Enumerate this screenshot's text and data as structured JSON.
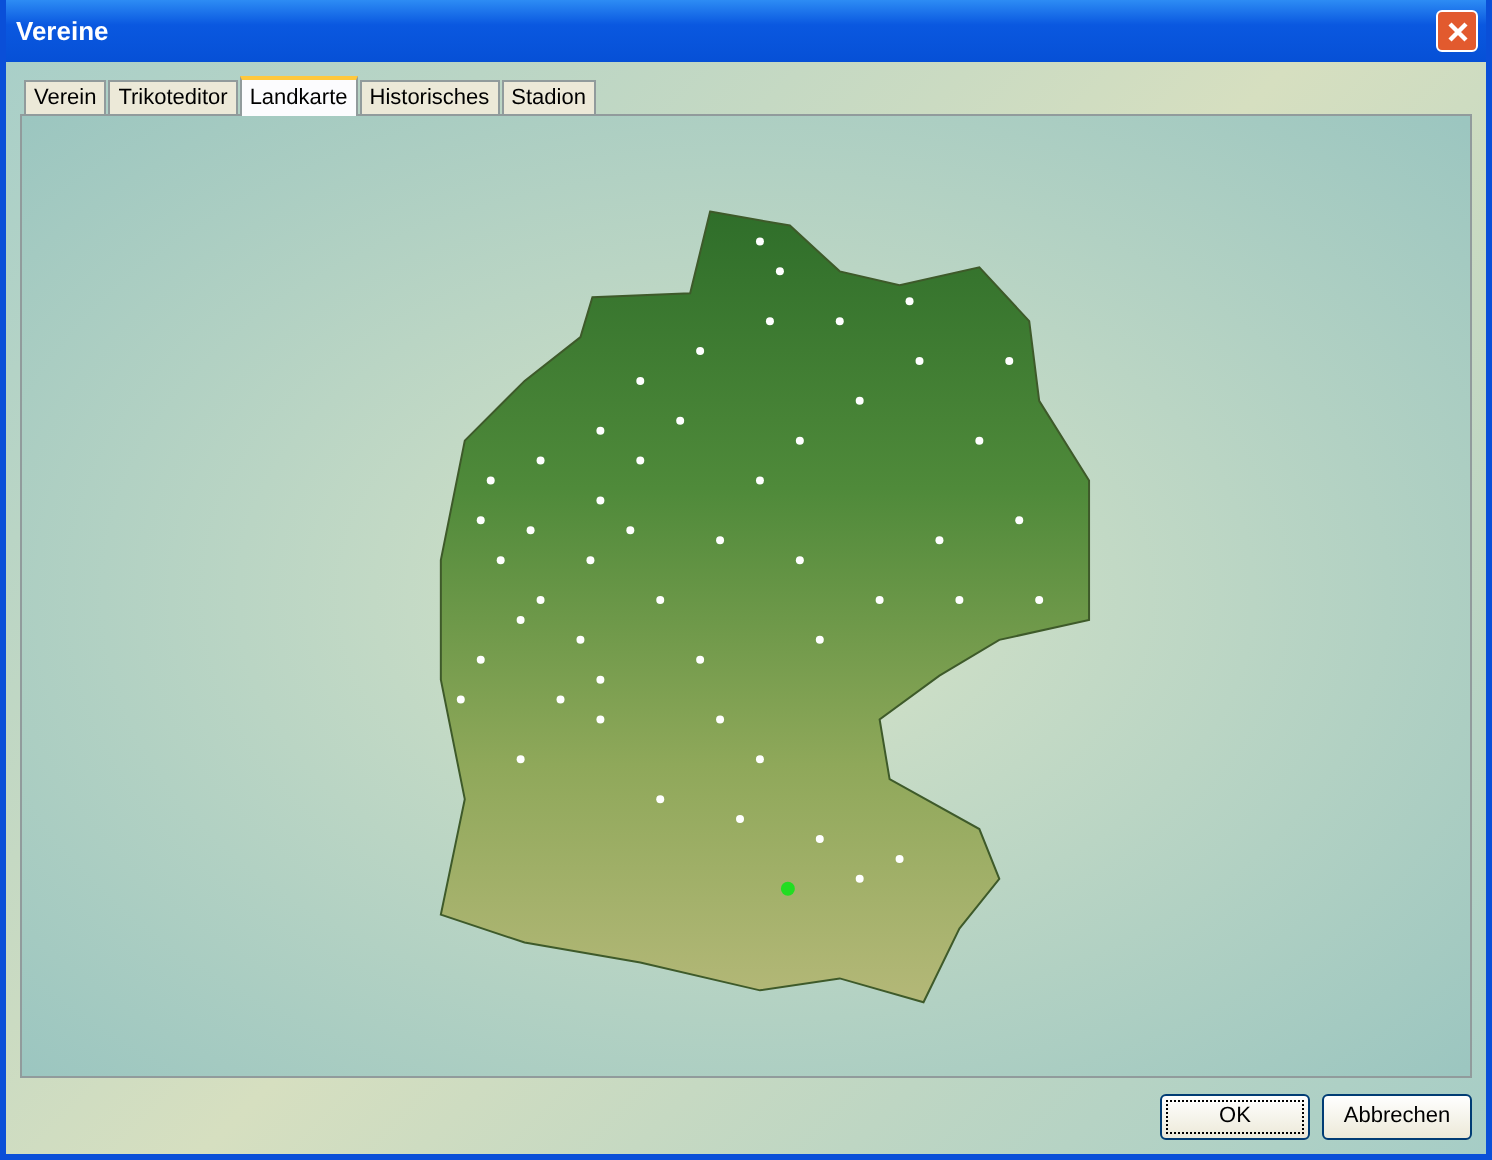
{
  "window": {
    "title": "Vereine"
  },
  "tabs": [
    {
      "label": "Verein",
      "selected": false
    },
    {
      "label": "Trikoteditor",
      "selected": false
    },
    {
      "label": "Landkarte",
      "selected": true
    },
    {
      "label": "Historisches",
      "selected": false
    },
    {
      "label": "Stadion",
      "selected": false
    }
  ],
  "buttons": [
    {
      "label": "OK",
      "focused": true
    },
    {
      "label": "Abbrechen",
      "focused": false
    }
  ]
}
